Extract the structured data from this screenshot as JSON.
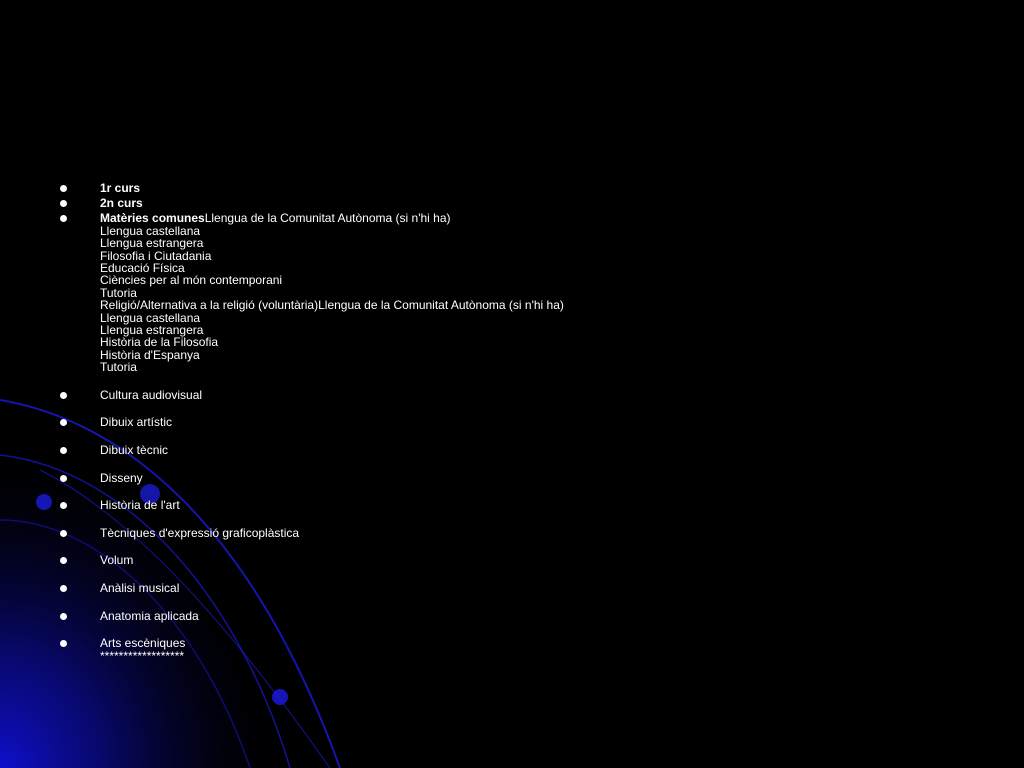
{
  "colors": {
    "background": "#000000",
    "text": "#ffffff",
    "accent": "#1a1aff"
  },
  "items": [
    {
      "title": "1r curs",
      "lines": []
    },
    {
      "title": "2n curs",
      "lines": []
    },
    {
      "title": "Matèries comunes",
      "first": "Llengua de la Comunitat Autònoma (si n'hi ha)",
      "lines": [
        "Llengua castellana",
        "Llengua estrangera",
        "Filosofia i Ciutadania",
        "Educació Física",
        "Ciències per al món contemporani",
        "Tutoria",
        "Religió/Alternativa a la religió (voluntària)Llengua de la Comunitat Autònoma (si n'hi ha)",
        "Llengua castellana",
        "Llengua estrangera",
        "Història de la Filosofia",
        "Història d'Espanya",
        "Tutoria"
      ]
    },
    {
      "text": "Cultura audiovisual"
    },
    {
      "text": "Dibuix artístic"
    },
    {
      "text": "Dibuix tècnic"
    },
    {
      "text": "Disseny"
    },
    {
      "text": "Història de l'art"
    },
    {
      "text": "Tècniques d'expressió graficoplàstica"
    },
    {
      "text": "Volum"
    },
    {
      "text": "Anàlisi musical"
    },
    {
      "text": "Anatomia aplicada"
    },
    {
      "text": "Arts escèniques",
      "after": "******************"
    }
  ]
}
